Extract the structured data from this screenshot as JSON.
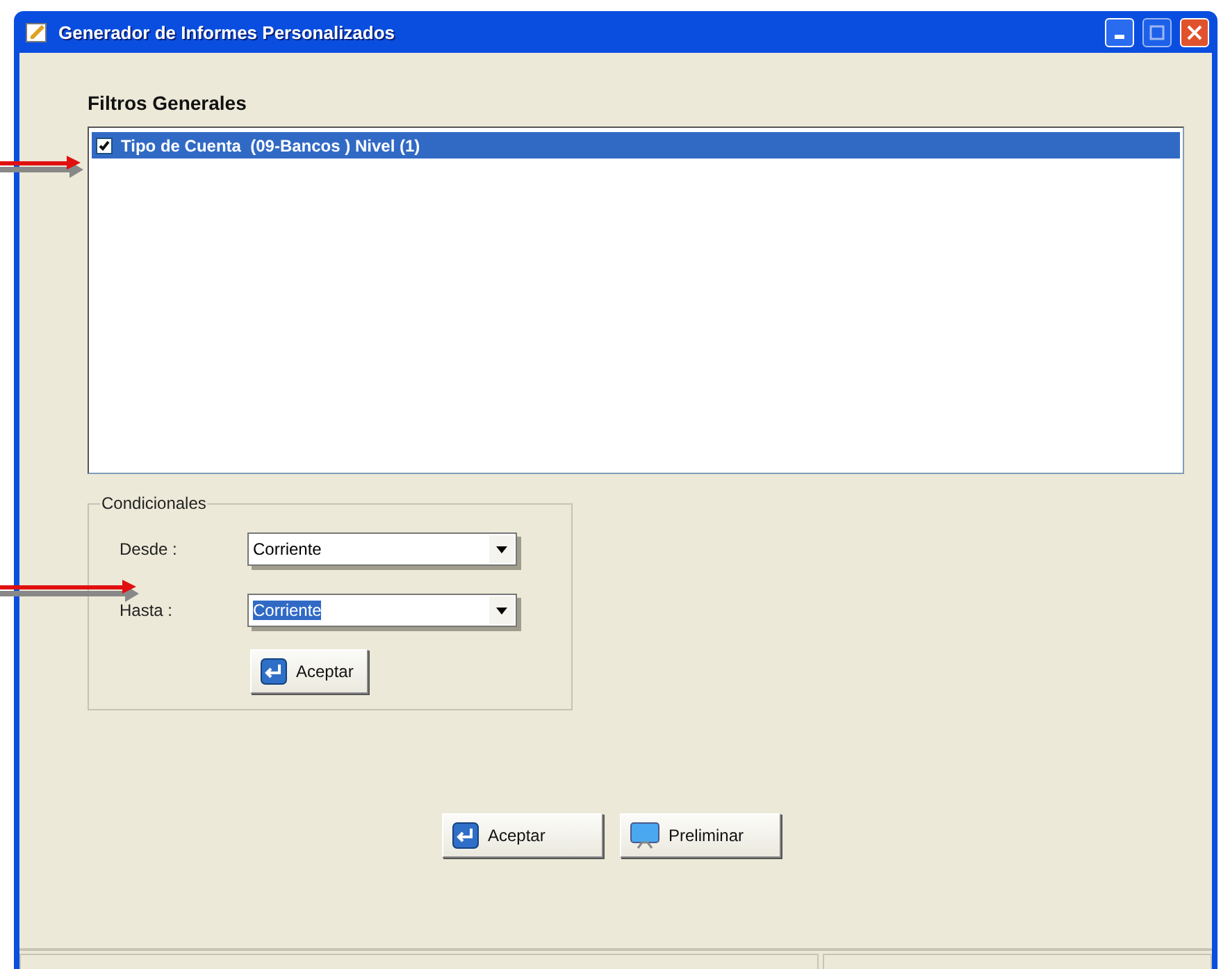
{
  "window": {
    "title": "Generador de Informes Personalizados"
  },
  "filters": {
    "title": "Filtros Generales",
    "items": [
      {
        "label": "Tipo de Cuenta  (09-Bancos ) Nivel (1)",
        "checked": true,
        "selected": true
      }
    ]
  },
  "conditionals": {
    "title": "Condicionales",
    "fields": [
      {
        "label": "Desde :",
        "value": "Corriente",
        "highlighted": false
      },
      {
        "label": "Hasta :",
        "value": "Corriente",
        "highlighted": true
      }
    ],
    "button": "Aceptar"
  },
  "buttons": [
    {
      "kind": "accept",
      "label": "Aceptar"
    },
    {
      "kind": "preview",
      "label": "Preliminar"
    }
  ]
}
